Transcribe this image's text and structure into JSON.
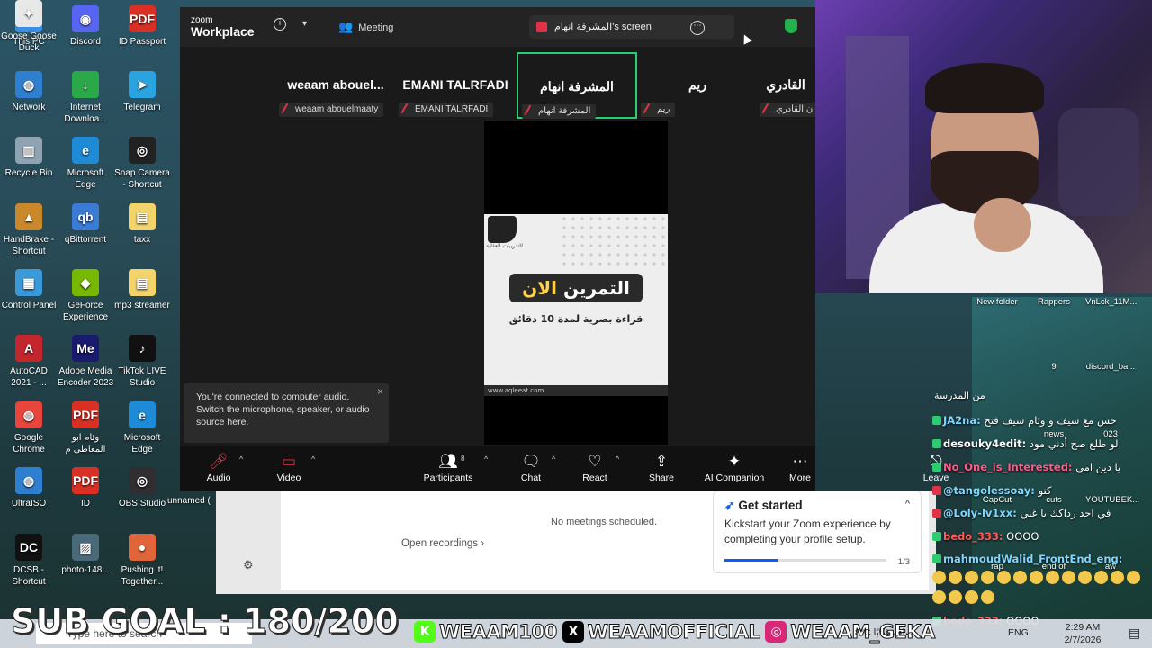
{
  "desktop": {
    "icons_left": [
      {
        "label": "This PC",
        "color": "#3a8ee6",
        "glyph": "▭"
      },
      {
        "label": "Discord",
        "color": "#5865f2",
        "glyph": "◉"
      },
      {
        "label": "ID Passport",
        "color": "#d93025",
        "glyph": "PDF"
      },
      {
        "label": "Network",
        "color": "#2f7fd1",
        "glyph": "◍"
      },
      {
        "label": "Internet Downloa...",
        "color": "#2aa84a",
        "glyph": "↓"
      },
      {
        "label": "Telegram",
        "color": "#2aa3e0",
        "glyph": "➤"
      },
      {
        "label": "Recycle Bin",
        "color": "#8fa3b3",
        "glyph": "▥"
      },
      {
        "label": "Microsoft Edge",
        "color": "#1f8ad6",
        "glyph": "e"
      },
      {
        "label": "Snap Camera - Shortcut",
        "color": "#222222",
        "glyph": "◎"
      },
      {
        "label": "HandBrake - Shortcut",
        "color": "#c9882a",
        "glyph": "▲"
      },
      {
        "label": "qBittorrent",
        "color": "#3b7bd6",
        "glyph": "qb"
      },
      {
        "label": "taxx",
        "color": "#f3d36b",
        "glyph": "▤"
      },
      {
        "label": "Control Panel",
        "color": "#3a9ad9",
        "glyph": "▦"
      },
      {
        "label": "GeForce Experience",
        "color": "#76b900",
        "glyph": "◆"
      },
      {
        "label": "mp3 streamer",
        "color": "#f3d36b",
        "glyph": "▤"
      },
      {
        "label": "AutoCAD 2021 - ...",
        "color": "#c4262e",
        "glyph": "A"
      },
      {
        "label": "Adobe Media Encoder 2023",
        "color": "#1a1a6e",
        "glyph": "Me"
      },
      {
        "label": "TikTok LIVE Studio",
        "color": "#111111",
        "glyph": "♪"
      },
      {
        "label": "Google Chrome",
        "color": "#e8453c",
        "glyph": "◍"
      },
      {
        "label": "وئام ابو المعاطى م",
        "color": "#d93025",
        "glyph": "PDF"
      },
      {
        "label": "Microsoft Edge",
        "color": "#1f8ad6",
        "glyph": "e"
      },
      {
        "label": "UltraISO",
        "color": "#2f7fd1",
        "glyph": "◍"
      },
      {
        "label": "ID",
        "color": "#d93025",
        "glyph": "PDF"
      },
      {
        "label": "OBS Studio",
        "color": "#302e31",
        "glyph": "◎"
      },
      {
        "label": "DCSB - Shortcut",
        "color": "#111111",
        "glyph": "DC"
      },
      {
        "label": "photo-148...",
        "color": "#4a6a7a",
        "glyph": "▨"
      },
      {
        "label": "Pushing it! Together...",
        "color": "#e0653a",
        "glyph": "●"
      },
      {
        "label": "Goose Goose Duck",
        "color": "#e8e8e8",
        "glyph": "✦"
      }
    ],
    "partial_label": "unnamed (",
    "icons_right": [
      {
        "label": "New folder"
      },
      {
        "label": "Rappers"
      },
      {
        "label": "VnLck_11M..."
      },
      {
        "label": "9"
      },
      {
        "label": "discord_ba..."
      },
      {
        "label": "news"
      },
      {
        "label": "023"
      },
      {
        "label": "CapCut"
      },
      {
        "label": "cuts"
      },
      {
        "label": "YOUTUBEK..."
      },
      {
        "label": "rap"
      },
      {
        "label": "end of"
      },
      {
        "label": "aw"
      }
    ]
  },
  "zoom": {
    "logo_top": "zoom",
    "logo_bottom": "Workplace",
    "meeting_label": "Meeting",
    "screen_label": "المشرفة انهام's screen",
    "tiles": [
      {
        "name": "weaam  abouel...",
        "sub": "weaam abouelmaaty"
      },
      {
        "name": "EMANI TALRFADI",
        "sub": "EMANI TALRFADI"
      },
      {
        "name": "المشرفة انهام",
        "sub": "المشرفة انهام"
      },
      {
        "name": "ريم",
        "sub": "ريم"
      },
      {
        "name": "القادري",
        "sub": "ان القادري"
      }
    ],
    "slide": {
      "logo_caption": "للتدريبات العقلية",
      "title_main": "التمرين ",
      "title_highlight": "الان",
      "subtitle": "قراءة بصرية لمدة 10 دقائق",
      "footer": "www.aqleeat.com"
    },
    "toast": "You're connected to computer audio. Switch the microphone, speaker, or audio source here.",
    "toolbar": {
      "audio": "Audio",
      "video": "Video",
      "participants": "Participants",
      "participants_count": "8",
      "chat": "Chat",
      "react": "React",
      "share": "Share",
      "ai": "AI Companion",
      "more": "More",
      "leave": "Leave"
    },
    "home": {
      "no_meetings": "No meetings scheduled.",
      "open_recordings": "Open recordings"
    },
    "get_started": {
      "title": "Get started",
      "desc": "Kickstart your Zoom experience by completing your profile setup.",
      "page": "1/3",
      "progress": 0.33
    }
  },
  "chat": {
    "header": "من المدرسة",
    "messages": [
      {
        "user": "JA2na:",
        "text": " حس مع سيف و وئام سيف فتح",
        "color": "#7fd6ff",
        "badge": "#2ecc71"
      },
      {
        "user": "desouky4edit:",
        "text": " لو طلع صح أدني مود",
        "color": "#ffffff",
        "badge": "#2ecc71"
      },
      {
        "user": "No_One_is_Interested:",
        "text": " يا دين امي",
        "color": "#ff5a8a",
        "badge": "#2ecc71"
      },
      {
        "user": "@tangolessoay:",
        "text": " كنو",
        "color": "#7fd6ff",
        "badge": "#e0334a"
      },
      {
        "user": "@Loly-lv1xx:",
        "text": " في احد رداكك يا غبي",
        "color": "#7fd6ff",
        "badge": "#e0334a"
      },
      {
        "user": "bedo_333:",
        "text": " OOOO",
        "color": "#ff5a5a",
        "badge": "#2ecc71"
      },
      {
        "user": "mahmoudWalid_FrontEnd_eng:",
        "text": "",
        "color": "#7fd6ff",
        "badge": "#2ecc71"
      },
      {
        "user": "bedo_333:",
        "text": " OOOO",
        "color": "#ff5a5a",
        "badge": "#2ecc71"
      }
    ]
  },
  "overlay": {
    "sub_goal": "SUB GOAL : 180/200",
    "socials": [
      {
        "text": "WEAAM100",
        "color": "#53fc18",
        "glyph": "K"
      },
      {
        "text": "WEAAMOFFICIAL",
        "color": "#000000",
        "glyph": "X"
      },
      {
        "text": "WEAAM_GEKA",
        "color": "#d62976",
        "glyph": "◎"
      }
    ]
  },
  "taskbar": {
    "search_placeholder": "Type here to search",
    "weather": "8°C  صافٍ غالبًا",
    "lang": "ENG",
    "time": "2:29 AM",
    "date": "2/7/2026"
  }
}
